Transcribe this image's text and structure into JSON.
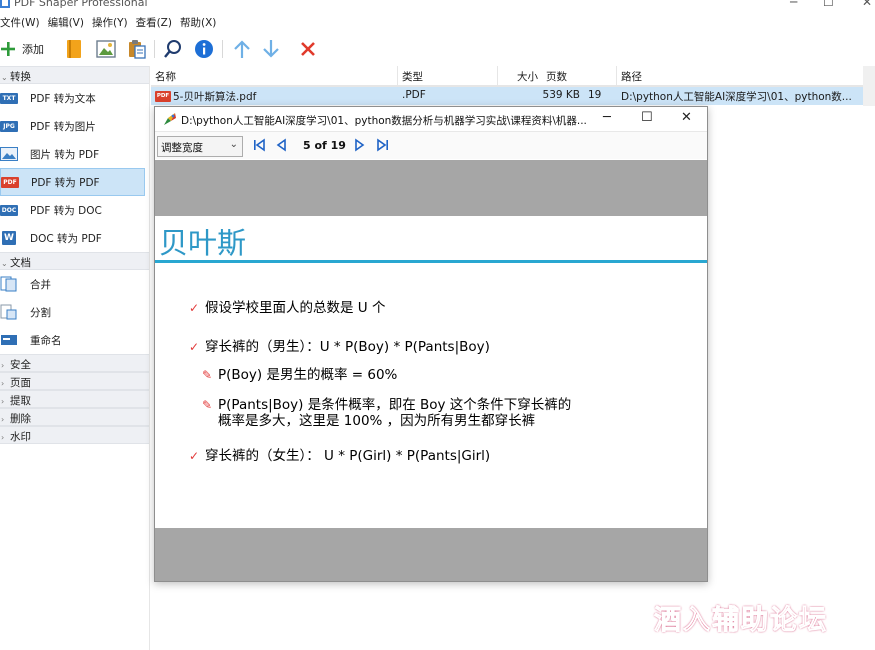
{
  "app": {
    "title": "PDF Shaper Professional",
    "window_controls": {
      "minimize": "─",
      "maximize": "☐",
      "close": "✕"
    }
  },
  "menu": [
    "文件(W)",
    "编辑(V)",
    "操作(Y)",
    "查看(Z)",
    "帮助(X)"
  ],
  "toolbar": {
    "add_label": "添加"
  },
  "sidebar": {
    "sections": [
      {
        "label": "转换",
        "items": [
          {
            "label": "PDF 转为文本",
            "badge": "TXT",
            "color": "#2f6fb5"
          },
          {
            "label": "PDF 转为图片",
            "badge": "JPG",
            "color": "#2f6fb5"
          },
          {
            "label": "图片 转为 PDF",
            "badge": "IMG",
            "color": "#3a7fc5"
          },
          {
            "label": "PDF 转为 PDF",
            "badge": "PDF",
            "color": "#d9412d",
            "active": true
          },
          {
            "label": "PDF 转为 DOC",
            "badge": "DOC",
            "color": "#2f6fb5"
          },
          {
            "label": "DOC 转为 PDF",
            "badge": "W",
            "color": "#2f6fb5"
          }
        ]
      },
      {
        "label": "文档",
        "items": [
          {
            "label": "合并"
          },
          {
            "label": "分割"
          },
          {
            "label": "重命名"
          }
        ]
      }
    ],
    "collapsed": [
      "安全",
      "页面",
      "提取",
      "删除",
      "水印"
    ]
  },
  "filelist": {
    "columns": [
      "名称",
      "类型",
      "大小",
      "页数",
      "路径"
    ],
    "rows": [
      {
        "name": "5-贝叶斯算法.pdf",
        "type": ".PDF",
        "size": "539 KB",
        "pages": "19",
        "path": "D:\\python人工智能AI深度学习\\01、python数..."
      }
    ]
  },
  "viewer": {
    "path": "D:\\python人工智能AI深度学习\\01、python数据分析与机器学习实战\\课程资料\\机器...",
    "zoom": "调整宽度",
    "page_indicator": "5 of 19",
    "slide": {
      "title": "贝叶斯",
      "bullets": [
        {
          "text": "假设学校里面人的总数是 U 个",
          "marker": "✓"
        },
        {
          "text": "穿长裤的（男生）：U * P(Boy) * P(Pants|Boy)",
          "marker": "✓"
        },
        {
          "text": "P(Boy) 是男生的概率 = 60%",
          "marker": "✎"
        },
        {
          "text": "P(Pants|Boy) 是条件概率，即在 Boy 这个条件下穿长裤的",
          "text2": "概率是多大，这里是 100% ，因为所有男生都穿长裤",
          "marker": "✎"
        },
        {
          "text": "穿长裤的（女生）： U * P(Girl) * P(Pants|Girl)",
          "marker": "✓"
        }
      ]
    }
  },
  "watermark": "酒入辅助论坛"
}
